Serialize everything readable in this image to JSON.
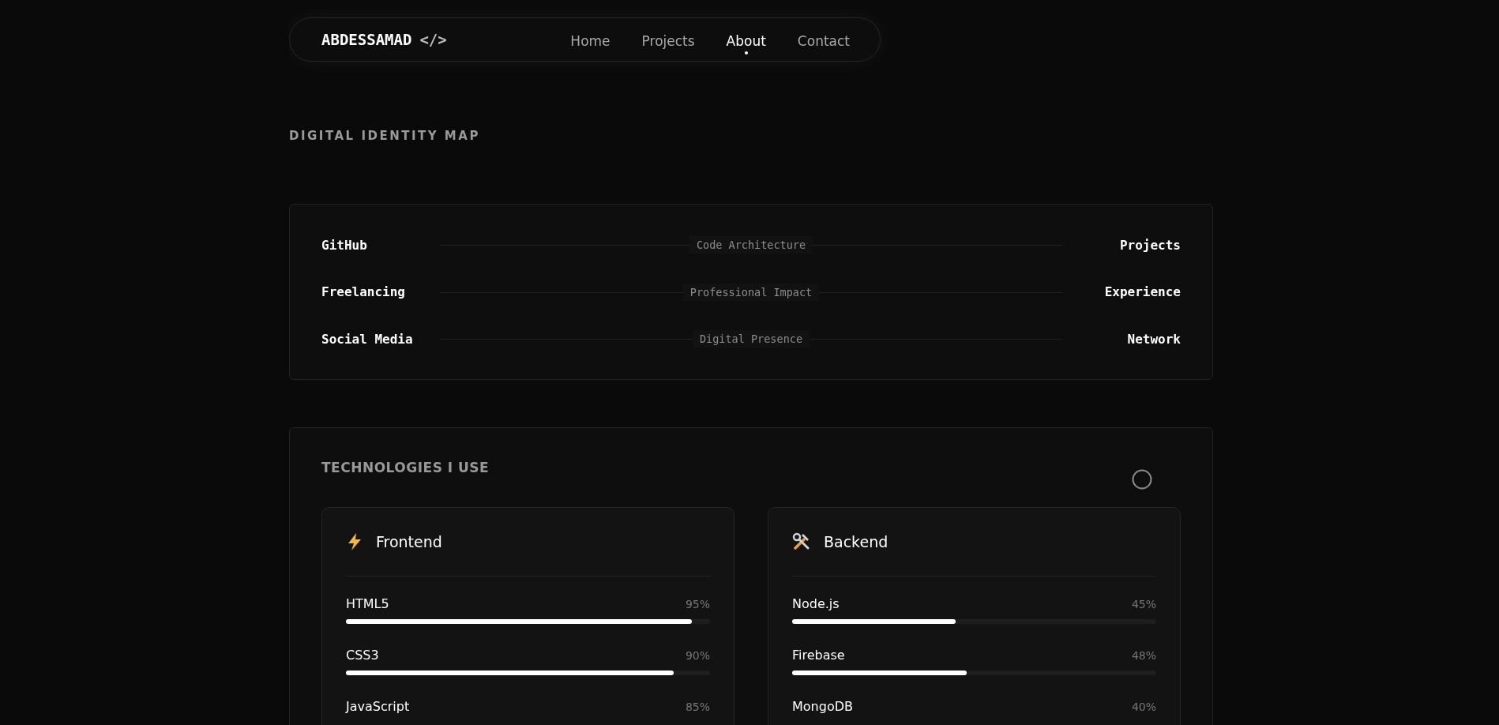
{
  "nav": {
    "brand": "ABDESSAMAD",
    "brand_symbol": "</>",
    "links": [
      {
        "label": "Home",
        "selected": false
      },
      {
        "label": "Projects",
        "selected": false
      },
      {
        "label": "About",
        "selected": true
      },
      {
        "label": "Contact",
        "selected": false
      }
    ]
  },
  "identity_map": {
    "title": "DIGITAL IDENTITY MAP",
    "rows": [
      {
        "left": "GitHub",
        "center": "Code Architecture",
        "right": "Projects"
      },
      {
        "left": "Freelancing",
        "center": "Professional Impact",
        "right": "Experience"
      },
      {
        "left": "Social Media",
        "center": "Digital Presence",
        "right": "Network"
      }
    ]
  },
  "technologies": {
    "title": "TECHNOLOGIES I USE",
    "groups": [
      {
        "name": "Frontend",
        "kind": "bolt",
        "skills": [
          {
            "name": "HTML5",
            "reading": "95%",
            "level": 0.95
          },
          {
            "name": "CSS3",
            "reading": "90%",
            "level": 0.9
          },
          {
            "name": "JavaScript",
            "reading": "85%"
          }
        ]
      },
      {
        "name": "Backend",
        "kind": "tools",
        "skills": [
          {
            "name": "Node.js",
            "reading": "45%",
            "level": 0.45
          },
          {
            "name": "Firebase",
            "reading": "48%",
            "level": 0.48
          },
          {
            "name": "MongoDB",
            "reading": "40%"
          }
        ]
      }
    ]
  }
}
